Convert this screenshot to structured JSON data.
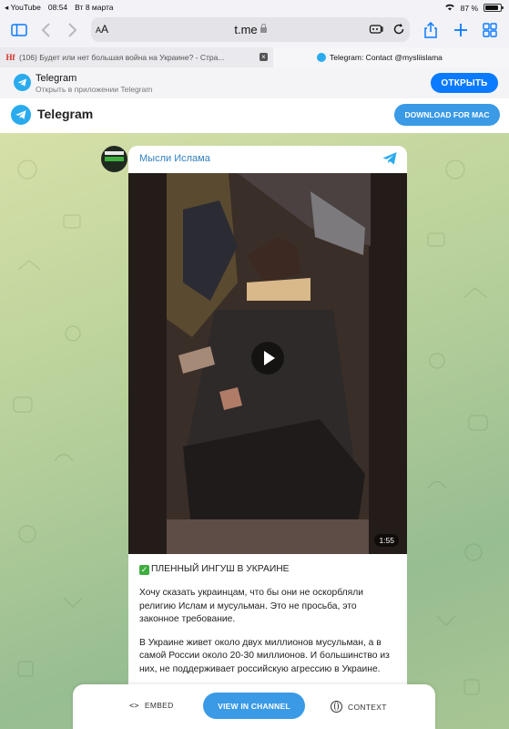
{
  "status_bar": {
    "back_app": "◂ YouTube",
    "time": "08:54",
    "date": "Вт 8 марта",
    "battery_percent": "87 %",
    "battery_level": 0.87
  },
  "browser": {
    "address_aa": "AA",
    "url": "t.me",
    "tabs": [
      {
        "title": "(106) Будет или нет большая война на Украине? - Стра..."
      },
      {
        "title": "Telegram: Contact @mysliislama"
      }
    ]
  },
  "smart_banner": {
    "title": "Telegram",
    "subtitle": "Открыть в приложении Telegram",
    "open_label": "ОТКРЫТЬ"
  },
  "tg_header": {
    "name": "Telegram",
    "download_label": "DOWNLOAD FOR MAC"
  },
  "post": {
    "channel_name": "Мысли Ислама",
    "video_duration": "1:55",
    "headline": "ПЛЕННЫЙ ИНГУШ В УКРАИНЕ",
    "paragraph1": "Хочу сказать украинцам, что бы они не оскорбляли религию Ислам и мусульман. Это не просьба, это законное требование.",
    "paragraph2": "В Украине живет около двух миллионов мусульман, а в самой России около 20-30 миллионов. И большинство из них, не поддерживает российскую агрессию в Украине."
  },
  "bottom_bar": {
    "embed_label": "EMBED",
    "view_label": "VIEW IN CHANNEL",
    "context_label": "CONTEXT"
  }
}
